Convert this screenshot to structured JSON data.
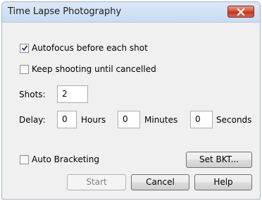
{
  "window": {
    "title": "Time Lapse Photography"
  },
  "options": {
    "autofocus": {
      "label": "Autofocus before each shot",
      "checked": true
    },
    "keep_shooting": {
      "label": "Keep shooting until cancelled",
      "checked": false
    }
  },
  "shots": {
    "label": "Shots:",
    "value": "2"
  },
  "delay": {
    "label": "Delay:",
    "hours_value": "0",
    "hours_label": "Hours",
    "minutes_value": "0",
    "minutes_label": "Minutes",
    "seconds_value": "0",
    "seconds_label": "Seconds"
  },
  "bracketing": {
    "label": "Auto Bracketing",
    "checked": false,
    "set_button": "Set BKT..."
  },
  "buttons": {
    "start": "Start",
    "cancel": "Cancel",
    "help": "Help"
  },
  "colors": {
    "close_button": "#c7432e",
    "titlebar": "#d3e3f5"
  }
}
